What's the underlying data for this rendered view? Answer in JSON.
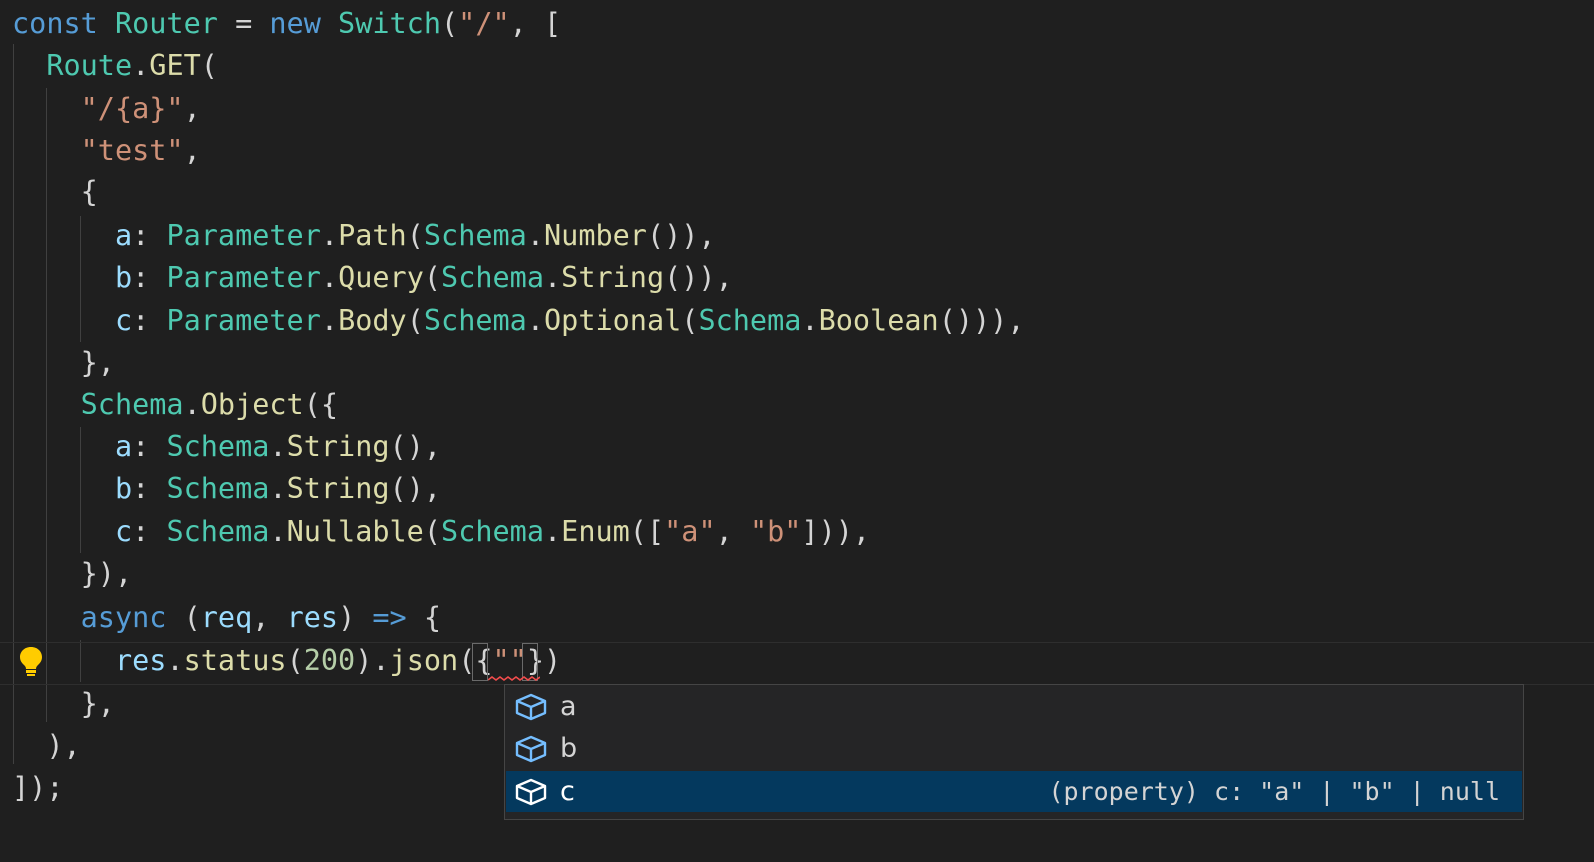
{
  "editor": {
    "lines": [
      [
        {
          "t": "kw",
          "v": "const "
        },
        {
          "t": "cls",
          "v": "Router"
        },
        {
          "t": "pun",
          "v": " = "
        },
        {
          "t": "kw",
          "v": "new "
        },
        {
          "t": "cls",
          "v": "Switch"
        },
        {
          "t": "pun",
          "v": "("
        },
        {
          "t": "str",
          "v": "\"/\""
        },
        {
          "t": "pun",
          "v": ", ["
        }
      ],
      [
        {
          "t": "pun",
          "v": "  "
        },
        {
          "t": "cls",
          "v": "Route"
        },
        {
          "t": "pun",
          "v": "."
        },
        {
          "t": "fn",
          "v": "GET"
        },
        {
          "t": "pun",
          "v": "("
        }
      ],
      [
        {
          "t": "pun",
          "v": "    "
        },
        {
          "t": "str",
          "v": "\"/{a}\""
        },
        {
          "t": "pun",
          "v": ","
        }
      ],
      [
        {
          "t": "pun",
          "v": "    "
        },
        {
          "t": "str",
          "v": "\"test\""
        },
        {
          "t": "pun",
          "v": ","
        }
      ],
      [
        {
          "t": "pun",
          "v": "    {"
        }
      ],
      [
        {
          "t": "pun",
          "v": "      "
        },
        {
          "t": "prop",
          "v": "a"
        },
        {
          "t": "pun",
          "v": ": "
        },
        {
          "t": "cls",
          "v": "Parameter"
        },
        {
          "t": "pun",
          "v": "."
        },
        {
          "t": "fn",
          "v": "Path"
        },
        {
          "t": "pun",
          "v": "("
        },
        {
          "t": "cls",
          "v": "Schema"
        },
        {
          "t": "pun",
          "v": "."
        },
        {
          "t": "fn",
          "v": "Number"
        },
        {
          "t": "pun",
          "v": "()),"
        }
      ],
      [
        {
          "t": "pun",
          "v": "      "
        },
        {
          "t": "prop",
          "v": "b"
        },
        {
          "t": "pun",
          "v": ": "
        },
        {
          "t": "cls",
          "v": "Parameter"
        },
        {
          "t": "pun",
          "v": "."
        },
        {
          "t": "fn",
          "v": "Query"
        },
        {
          "t": "pun",
          "v": "("
        },
        {
          "t": "cls",
          "v": "Schema"
        },
        {
          "t": "pun",
          "v": "."
        },
        {
          "t": "fn",
          "v": "String"
        },
        {
          "t": "pun",
          "v": "()),"
        }
      ],
      [
        {
          "t": "pun",
          "v": "      "
        },
        {
          "t": "prop",
          "v": "c"
        },
        {
          "t": "pun",
          "v": ": "
        },
        {
          "t": "cls",
          "v": "Parameter"
        },
        {
          "t": "pun",
          "v": "."
        },
        {
          "t": "fn",
          "v": "Body"
        },
        {
          "t": "pun",
          "v": "("
        },
        {
          "t": "cls",
          "v": "Schema"
        },
        {
          "t": "pun",
          "v": "."
        },
        {
          "t": "fn",
          "v": "Optional"
        },
        {
          "t": "pun",
          "v": "("
        },
        {
          "t": "cls",
          "v": "Schema"
        },
        {
          "t": "pun",
          "v": "."
        },
        {
          "t": "fn",
          "v": "Boolean"
        },
        {
          "t": "pun",
          "v": "())),"
        }
      ],
      [
        {
          "t": "pun",
          "v": "    },"
        }
      ],
      [
        {
          "t": "pun",
          "v": "    "
        },
        {
          "t": "cls",
          "v": "Schema"
        },
        {
          "t": "pun",
          "v": "."
        },
        {
          "t": "fn",
          "v": "Object"
        },
        {
          "t": "pun",
          "v": "({"
        }
      ],
      [
        {
          "t": "pun",
          "v": "      "
        },
        {
          "t": "prop",
          "v": "a"
        },
        {
          "t": "pun",
          "v": ": "
        },
        {
          "t": "cls",
          "v": "Schema"
        },
        {
          "t": "pun",
          "v": "."
        },
        {
          "t": "fn",
          "v": "String"
        },
        {
          "t": "pun",
          "v": "(),"
        }
      ],
      [
        {
          "t": "pun",
          "v": "      "
        },
        {
          "t": "prop",
          "v": "b"
        },
        {
          "t": "pun",
          "v": ": "
        },
        {
          "t": "cls",
          "v": "Schema"
        },
        {
          "t": "pun",
          "v": "."
        },
        {
          "t": "fn",
          "v": "String"
        },
        {
          "t": "pun",
          "v": "(),"
        }
      ],
      [
        {
          "t": "pun",
          "v": "      "
        },
        {
          "t": "prop",
          "v": "c"
        },
        {
          "t": "pun",
          "v": ": "
        },
        {
          "t": "cls",
          "v": "Schema"
        },
        {
          "t": "pun",
          "v": "."
        },
        {
          "t": "fn",
          "v": "Nullable"
        },
        {
          "t": "pun",
          "v": "("
        },
        {
          "t": "cls",
          "v": "Schema"
        },
        {
          "t": "pun",
          "v": "."
        },
        {
          "t": "fn",
          "v": "Enum"
        },
        {
          "t": "pun",
          "v": "(["
        },
        {
          "t": "str",
          "v": "\"a\""
        },
        {
          "t": "pun",
          "v": ", "
        },
        {
          "t": "str",
          "v": "\"b\""
        },
        {
          "t": "pun",
          "v": "])),"
        }
      ],
      [
        {
          "t": "pun",
          "v": "    }),"
        }
      ],
      [
        {
          "t": "pun",
          "v": "    "
        },
        {
          "t": "kw",
          "v": "async"
        },
        {
          "t": "pun",
          "v": " ("
        },
        {
          "t": "var",
          "v": "req"
        },
        {
          "t": "pun",
          "v": ", "
        },
        {
          "t": "var",
          "v": "res"
        },
        {
          "t": "pun",
          "v": ") "
        },
        {
          "t": "kw",
          "v": "=>"
        },
        {
          "t": "pun",
          "v": " {"
        }
      ],
      [
        {
          "t": "pun",
          "v": "      "
        },
        {
          "t": "var",
          "v": "res"
        },
        {
          "t": "pun",
          "v": "."
        },
        {
          "t": "fn",
          "v": "status"
        },
        {
          "t": "pun",
          "v": "("
        },
        {
          "t": "num",
          "v": "200"
        },
        {
          "t": "pun",
          "v": ")."
        },
        {
          "t": "fn",
          "v": "json"
        },
        {
          "t": "pun",
          "v": "({"
        },
        {
          "t": "str",
          "v": "\"\""
        },
        {
          "t": "pun",
          "v": "})"
        }
      ],
      [
        {
          "t": "pun",
          "v": "    },"
        }
      ],
      [
        {
          "t": "pun",
          "v": "  ),"
        }
      ],
      [
        {
          "t": "pun",
          "v": "]);"
        }
      ]
    ]
  },
  "suggest": {
    "items": [
      {
        "label": "a",
        "detail": "",
        "icon": "property-cube-icon"
      },
      {
        "label": "b",
        "detail": "",
        "icon": "property-cube-icon"
      },
      {
        "label": "c",
        "detail": "(property) c: \"a\" | \"b\" | null",
        "icon": "property-cube-icon",
        "selected": true
      }
    ]
  },
  "colors": {
    "background": "#1f1f1f",
    "keyword": "#569cd6",
    "type": "#4ec9b0",
    "function": "#dcdcaa",
    "string": "#ce9178",
    "number": "#b5cea8",
    "property": "#9cdcfe",
    "selection": "#04395e",
    "lightbulb": "#ffcc00",
    "error_squiggle": "#f14c4c"
  }
}
